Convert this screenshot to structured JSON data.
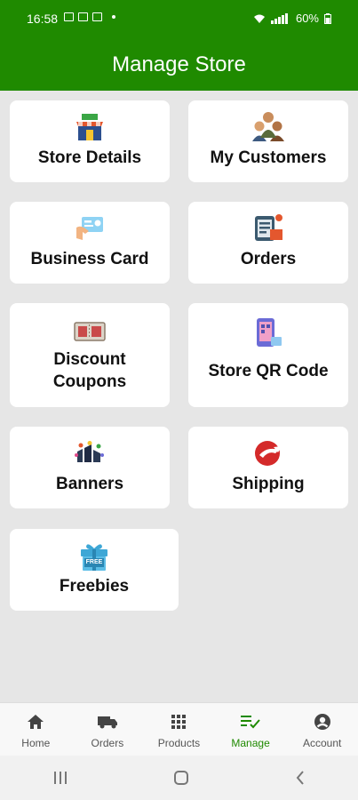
{
  "status": {
    "time": "16:58",
    "battery": "60%"
  },
  "header": {
    "title": "Manage Store"
  },
  "cards": {
    "store_details": "Store Details",
    "my_customers": "My Customers",
    "business_card": "Business Card",
    "orders": "Orders",
    "discount_coupons_line1": "Discount",
    "discount_coupons_line2": "Coupons",
    "store_qr": "Store QR Code",
    "banners": "Banners",
    "shipping": "Shipping",
    "freebies": "Freebies",
    "freebie_badge": "FREE"
  },
  "nav": {
    "home": "Home",
    "orders": "Orders",
    "products": "Products",
    "manage": "Manage",
    "account": "Account"
  },
  "colors": {
    "primary": "#1f8a00",
    "background": "#e6e6e6"
  }
}
